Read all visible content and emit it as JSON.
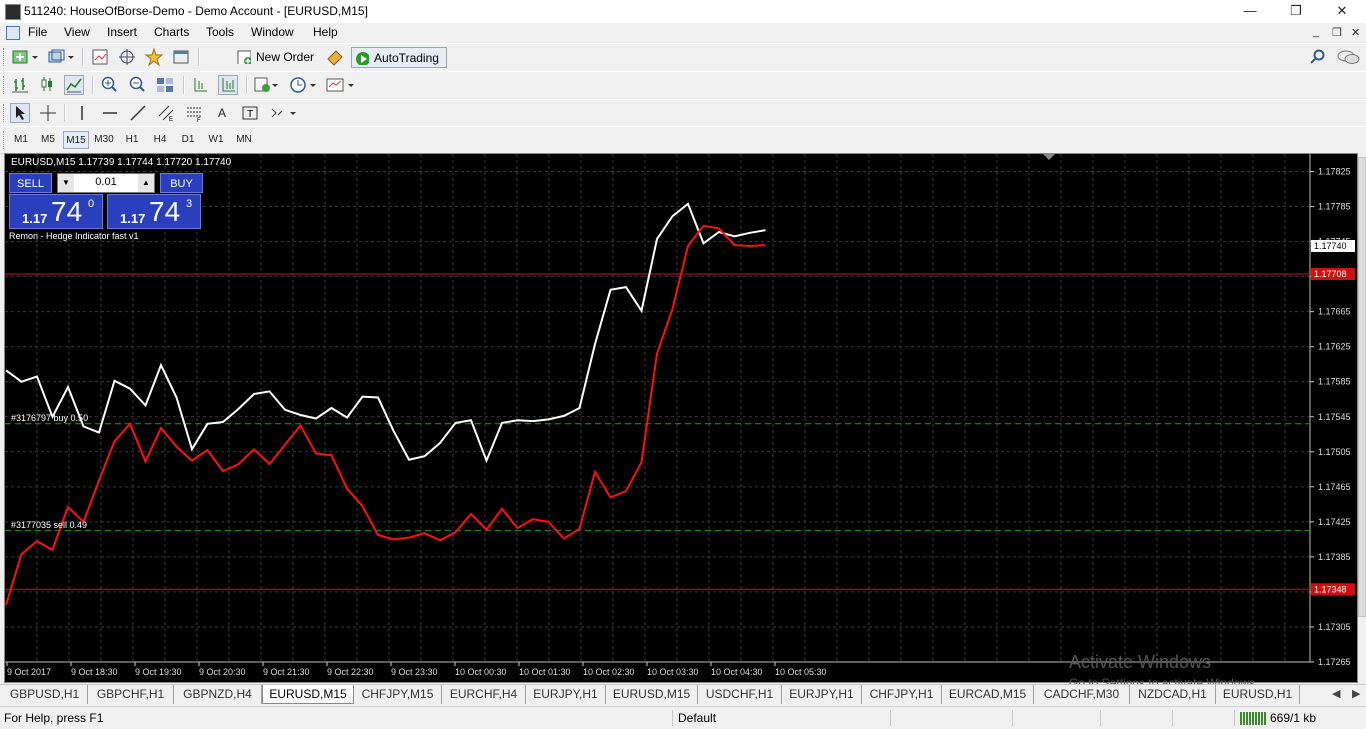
{
  "window": {
    "title": "511240: HouseOfBorse-Demo - Demo Account - [EURUSD,M15]",
    "minimize": "—",
    "maximize": "❐",
    "close": "✕"
  },
  "menu": [
    "File",
    "View",
    "Insert",
    "Charts",
    "Tools",
    "Window",
    "Help"
  ],
  "mdi_controls": {
    "minimize": "_",
    "restore": "❐",
    "close": "✕"
  },
  "toolbar1": {
    "new_order": "New Order",
    "autotrading": "AutoTrading"
  },
  "timeframes": [
    "M1",
    "M5",
    "M15",
    "M30",
    "H1",
    "H4",
    "D1",
    "W1",
    "MN"
  ],
  "active_timeframe": "M15",
  "chart": {
    "header": "EURUSD,M15  1.17739 1.17744 1.17720 1.17740",
    "sell_label": "SELL",
    "buy_label": "BUY",
    "lot": "0.01",
    "sell_price": {
      "small": "1.17",
      "big": "74",
      "sup": "0"
    },
    "buy_price": {
      "small": "1.17",
      "big": "74",
      "sup": "3"
    },
    "indicator_label": "Remon - Hedge Indicator fast v1",
    "order1_label": "#3176797 buy 0.50",
    "order2_label": "#3177035 sell 0.49",
    "current_price_tag": "1.17740",
    "red_level_upper": "1.17708",
    "red_level_lower": "1.17348",
    "colors": {
      "background": "#000000",
      "grid": "#3a3a3a",
      "line_white": "#ffffff",
      "line_red": "#ff1010",
      "order_line": "#1f9a1f",
      "level_line": "#d01010"
    }
  },
  "chart_data": {
    "type": "line",
    "title": "EURUSD,M15",
    "y_ticks": [
      "1.17825",
      "1.17785",
      "1.17745",
      "1.17705",
      "1.17665",
      "1.17625",
      "1.17585",
      "1.17545",
      "1.17505",
      "1.17465",
      "1.17425",
      "1.17385",
      "1.17345",
      "1.17305",
      "1.17265"
    ],
    "x_ticks": [
      "9 Oct 2017",
      "9 Oct 18:30",
      "9 Oct 19:30",
      "9 Oct 20:30",
      "9 Oct 21:30",
      "9 Oct 22:30",
      "9 Oct 23:30",
      "10 Oct 00:30",
      "10 Oct 01:30",
      "10 Oct 02:30",
      "10 Oct 03:30",
      "10 Oct 04:30",
      "10 Oct 05:30"
    ],
    "ylim": [
      1.17265,
      1.17845
    ],
    "grid": true,
    "series": [
      {
        "color": "#ffffff",
        "values": [
          1.17598,
          1.17585,
          1.17591,
          1.17545,
          1.17579,
          1.17534,
          1.17527,
          1.17586,
          1.17577,
          1.17558,
          1.17604,
          1.17567,
          1.17508,
          1.17537,
          1.17539,
          1.17554,
          1.17571,
          1.17574,
          1.17553,
          1.17547,
          1.17543,
          1.17555,
          1.17544,
          1.17568,
          1.17567,
          1.17529,
          1.17496,
          1.175,
          1.17515,
          1.17538,
          1.17541,
          1.17495,
          1.17538,
          1.17541,
          1.1754,
          1.17542,
          1.17546,
          1.17555,
          1.17628,
          1.1769,
          1.17693,
          1.17666,
          1.17748,
          1.17774,
          1.17788,
          1.17743,
          1.17756,
          1.17751,
          1.17755,
          1.17758
        ]
      },
      {
        "color": "#ff1010",
        "values": [
          1.1733,
          1.17388,
          1.17403,
          1.17393,
          1.17442,
          1.17425,
          1.17472,
          1.17517,
          1.17537,
          1.17494,
          1.17532,
          1.17511,
          1.17495,
          1.17507,
          1.17483,
          1.17491,
          1.17508,
          1.17491,
          1.17513,
          1.17535,
          1.17503,
          1.17501,
          1.17463,
          1.17443,
          1.1741,
          1.17405,
          1.17407,
          1.17412,
          1.17404,
          1.17413,
          1.17434,
          1.17416,
          1.1744,
          1.17418,
          1.17428,
          1.17425,
          1.17406,
          1.17417,
          1.17482,
          1.17453,
          1.1746,
          1.17493,
          1.17617,
          1.17668,
          1.1774,
          1.17763,
          1.1776,
          1.17741,
          1.1774,
          1.17741
        ]
      }
    ],
    "levels": [
      {
        "price": 1.17708,
        "color": "#d01010",
        "style": "solid"
      },
      {
        "price": 1.17348,
        "color": "#d01010",
        "style": "solid"
      },
      {
        "price": 1.17537,
        "color": "#1f9a1f",
        "style": "dashed"
      },
      {
        "price": 1.17415,
        "color": "#1f9a1f",
        "style": "dashed"
      }
    ],
    "current_price": 1.1774
  },
  "tabs": [
    "GBPUSD,H1",
    "GBPCHF,H1",
    "GBPNZD,H4",
    "EURUSD,M15",
    "CHFJPY,M15",
    "EURCHF,H4",
    "EURJPY,H1",
    "EURUSD,M15",
    "USDCHF,H1",
    "EURJPY,H1",
    "CHFJPY,H1",
    "EURCAD,M15",
    "CADCHF,M30",
    "NZDCAD,H1",
    "EURUSD,H1"
  ],
  "active_tab_index": 3,
  "watermark": {
    "line1": "Activate Windows",
    "line2": "Go to Settings to activate Windows."
  },
  "status": {
    "help": "For Help, press F1",
    "profile": "Default",
    "connection": "669/1 kb"
  }
}
